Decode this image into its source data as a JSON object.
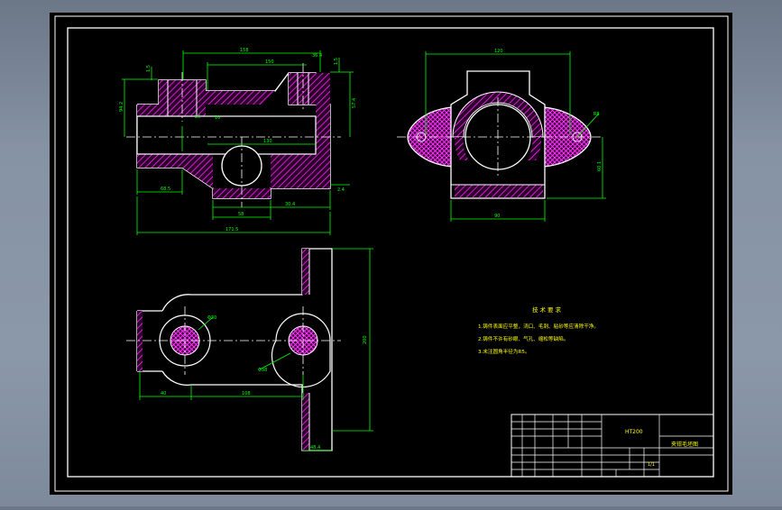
{
  "drawing": {
    "title_block": {
      "material": "HT200",
      "part_name": "夹钳毛坯图",
      "scale": "1/1"
    },
    "tech_requirements": {
      "heading": "技术要求",
      "items": [
        "1.铸件表面应平整，浇口、毛刺、粘砂等应清除干净。",
        "2.铸件不许有砂眼、气孔、缩松等缺陷。",
        "3.未注圆角半径为R5。"
      ]
    }
  },
  "colors": {
    "sheet": "#000000",
    "frame": "#ffffff",
    "outline": "#ffffff",
    "dimension": "#00ff00",
    "hatch": "#ff00ff",
    "centerline": "#ffffff",
    "note_text": "#ffff00"
  }
}
